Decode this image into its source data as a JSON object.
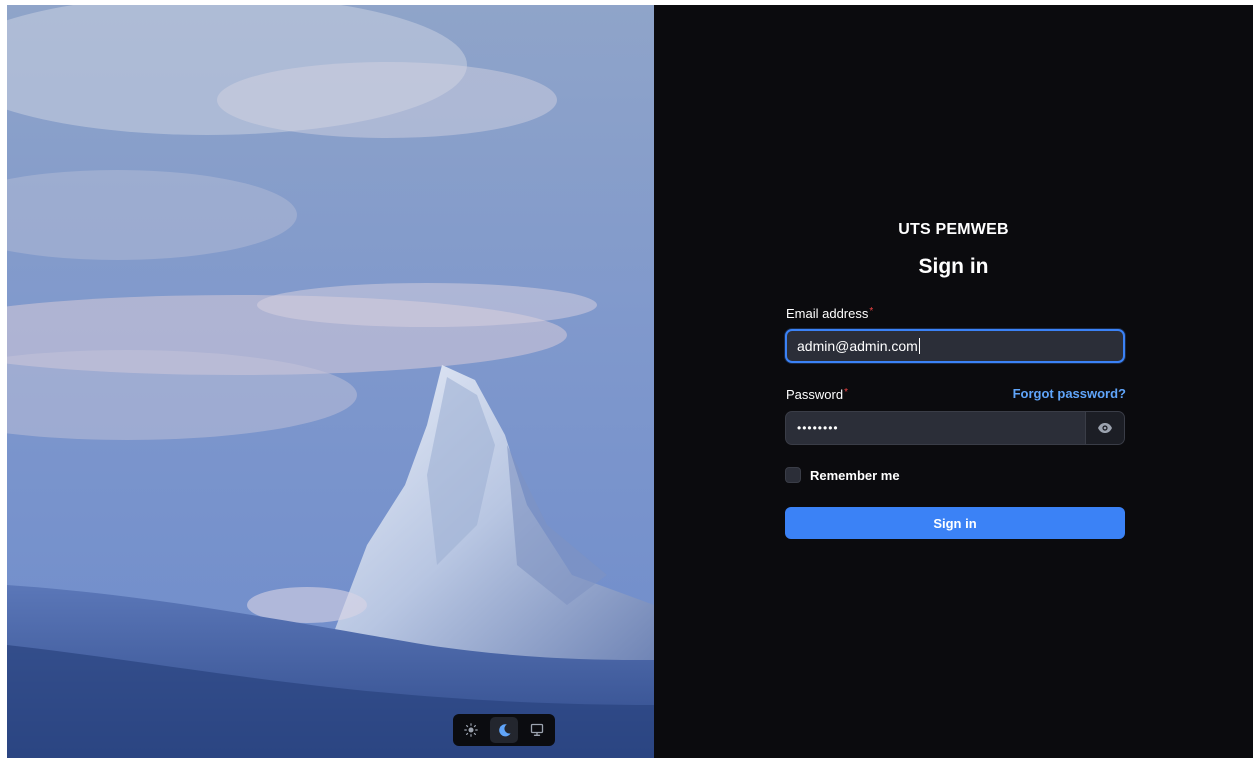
{
  "brand": {
    "name": "UTS PEMWEB"
  },
  "form": {
    "heading": "Sign in",
    "email": {
      "label": "Email address",
      "required_mark": "*",
      "value": "admin@admin.com"
    },
    "password": {
      "label": "Password",
      "required_mark": "*",
      "masked_value": "••••••••",
      "forgot_link": "Forgot password?"
    },
    "remember": {
      "label": "Remember me",
      "checked": false
    },
    "submit_label": "Sign in"
  },
  "theme_switcher": {
    "options": [
      {
        "icon": "sun-icon",
        "active": false
      },
      {
        "icon": "moon-icon",
        "active": true
      },
      {
        "icon": "monitor-icon",
        "active": false
      }
    ]
  },
  "colors": {
    "accent": "#3b82f6",
    "link": "#60a5fa",
    "panel_bg": "#0b0b0e",
    "input_bg": "#2b2e38",
    "required": "#ef4444"
  }
}
